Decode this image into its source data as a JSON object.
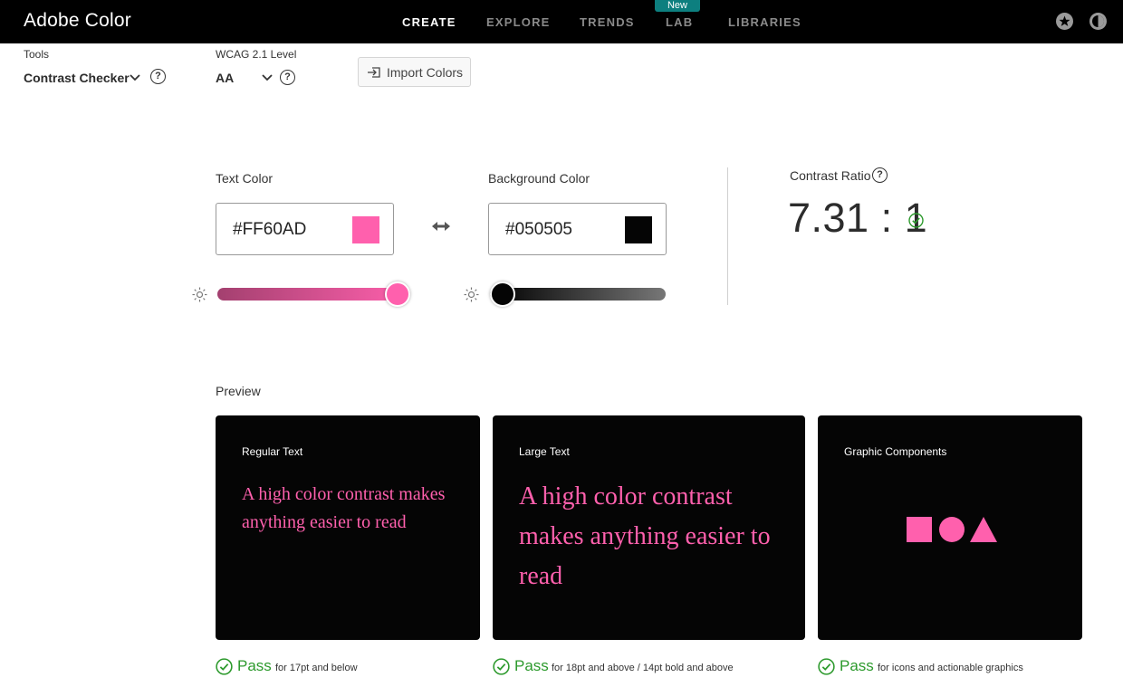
{
  "app": {
    "title": "Adobe Color"
  },
  "nav": {
    "items": [
      "CREATE",
      "EXPLORE",
      "TRENDS",
      "LAB",
      "LIBRARIES"
    ],
    "active": "CREATE",
    "badge": "New"
  },
  "tools": {
    "label": "Tools",
    "value": "Contrast Checker",
    "wcag_label": "WCAG 2.1 Level",
    "wcag_value": "AA",
    "help_glyph": "?",
    "import_label": "Import Colors"
  },
  "text_color": {
    "label": "Text Color",
    "hex": "#FF60AD",
    "swatch": "#ff60ad",
    "brightness": 1.0
  },
  "background_color": {
    "label": "Background Color",
    "hex": "#050505",
    "swatch": "#050505",
    "brightness": 0.0
  },
  "contrast": {
    "label": "Contrast Ratio",
    "value": "7.31 : 1"
  },
  "preview": {
    "label": "Preview",
    "cards": [
      {
        "title": "Regular Text",
        "text": "A high color contrast makes anything easier to read"
      },
      {
        "title": "Large Text",
        "text": "A high color contrast makes anything easier to read"
      },
      {
        "title": "Graphic Components"
      }
    ],
    "results": [
      {
        "status": "Pass",
        "desc": "for 17pt and below"
      },
      {
        "status": "Pass",
        "desc": "for 18pt and above / 14pt bold and above"
      },
      {
        "status": "Pass",
        "desc": "for icons and actionable graphics"
      }
    ]
  },
  "colors": {
    "accent": "#ff60ad",
    "pass": "#2d9a2d",
    "card_bg": "#050505"
  }
}
